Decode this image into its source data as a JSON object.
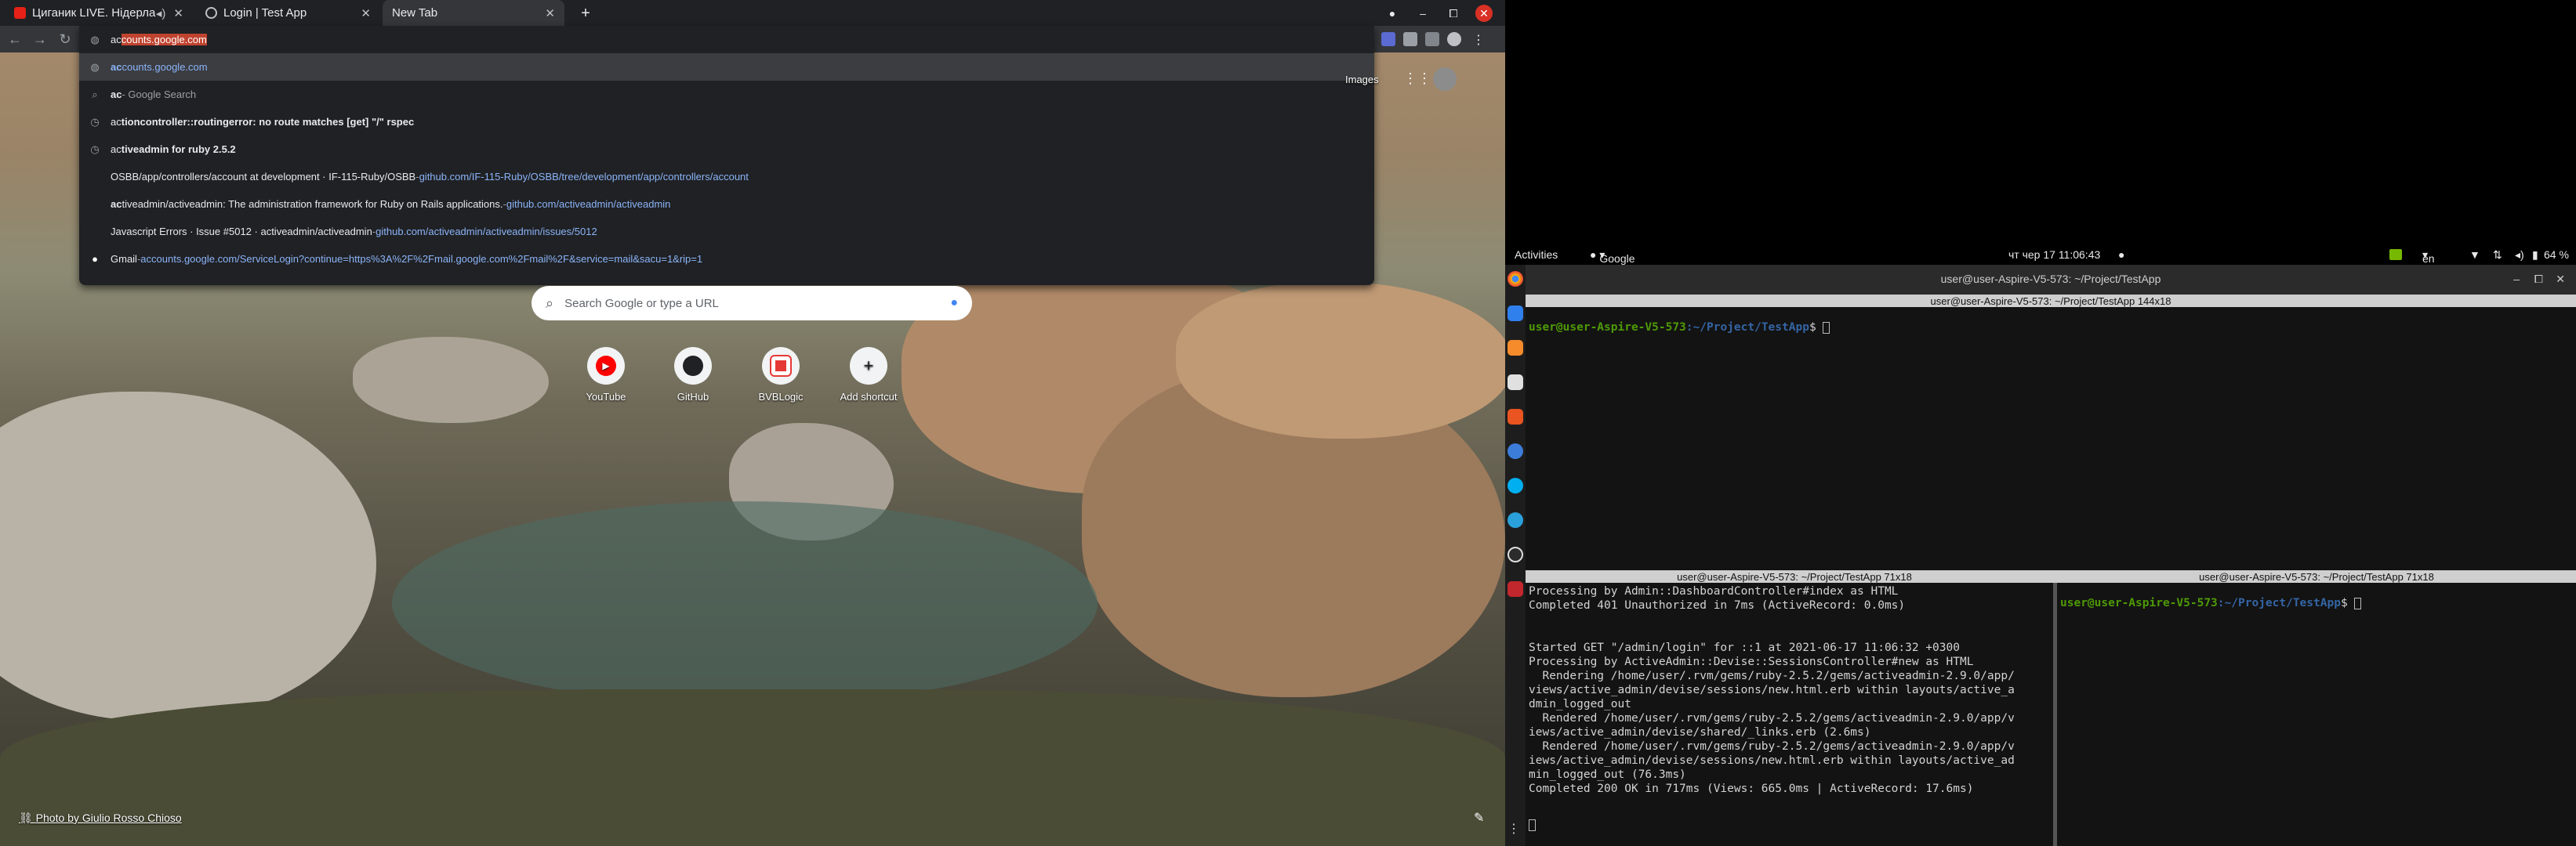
{
  "chrome": {
    "tabs": [
      {
        "label": "Циганик LIVE. Нідерла",
        "active": false,
        "favicon": "youtube-icon"
      },
      {
        "label": "Login | Test App",
        "active": false,
        "favicon": "globe-icon"
      },
      {
        "label": "New Tab",
        "active": true
      }
    ],
    "omnibox": {
      "typed": "ac",
      "autocomplete": "counts.google.com",
      "suggestions": [
        {
          "icon": "globe-icon",
          "bold": "ac",
          "rest": "counts.google.com",
          "suffix": "",
          "url": "",
          "style": "url"
        },
        {
          "icon": "search-icon",
          "bold": "ac",
          "rest": "",
          "suffix": " - Google Search",
          "url": ""
        },
        {
          "icon": "history-icon",
          "bold": "ac",
          "rest": "tioncontroller::routingerror: no route matches [get] \"/\" rspec",
          "suffix": "",
          "url": ""
        },
        {
          "icon": "history-icon",
          "bold": "ac",
          "rest": "tiveadmin for ruby 2.5.2",
          "suffix": "",
          "url": ""
        },
        {
          "icon": "",
          "bold": "",
          "rest": "OSBB/app/controllers/account at development · IF-115-Ruby/OSBB",
          "suffix": " - ",
          "url": "github.com/IF-115-Ruby/OSBB/tree/development/app/controllers/account"
        },
        {
          "icon": "",
          "bold": "ac",
          "rest": "tiveadmin/activeadmin: The administration framework for Ruby on Rails applications.",
          "suffix": " - ",
          "url": "github.com/activeadmin/activeadmin"
        },
        {
          "icon": "",
          "bold": "",
          "rest": "Javascript Errors · Issue #5012 · activeadmin/activeadmin",
          "suffix": " - ",
          "url": "github.com/activeadmin/activeadmin/issues/5012"
        },
        {
          "icon": "google-icon",
          "bold": "",
          "rest": "Gmail",
          "suffix": " - ",
          "url": "accounts.google.com/ServiceLogin?continue=https%3A%2F%2Fmail.google.com%2Fmail%2F&service=mail&sacu=1&rip=1"
        }
      ]
    },
    "images_link": "Images",
    "search_placeholder": "Search Google or type a URL",
    "shortcuts": [
      {
        "label": "YouTube",
        "icon": "youtube-icon"
      },
      {
        "label": "GitHub",
        "icon": "github-icon"
      },
      {
        "label": "BVBLogic",
        "icon": "bvblogic-icon"
      },
      {
        "label": "Add shortcut",
        "icon": "plus-icon"
      }
    ],
    "photo_credit": "Photo by Giulio Rosso Chioso"
  },
  "ubuntu": {
    "activities": "Activities",
    "app_menu": "Google Chrome",
    "clock": "чт чер 17  11:06:43",
    "lang": "en",
    "battery": "64 %",
    "terminal_title": "user@user-Aspire-V5-573: ~/Project/TestApp",
    "pane_top_title": "user@user-Aspire-V5-573: ~/Project/TestApp 144x18",
    "pane_bl_title": "user@user-Aspire-V5-573: ~/Project/TestApp 71x18",
    "pane_br_title": "user@user-Aspire-V5-573: ~/Project/TestApp 71x18",
    "prompt_user": "user@user-Aspire-V5-573",
    "prompt_path": ":~/Project/TestApp",
    "log_lines": [
      "Processing by Admin::DashboardController#index as HTML",
      "Completed 401 Unauthorized in 7ms (ActiveRecord: 0.0ms)",
      "",
      "",
      "Started GET \"/admin/login\" for ::1 at 2021-06-17 11:06:32 +0300",
      "Processing by ActiveAdmin::Devise::SessionsController#new as HTML",
      "  Rendering /home/user/.rvm/gems/ruby-2.5.2/gems/activeadmin-2.9.0/app/",
      "views/active_admin/devise/sessions/new.html.erb within layouts/active_a",
      "dmin_logged_out",
      "  Rendered /home/user/.rvm/gems/ruby-2.5.2/gems/activeadmin-2.9.0/app/v",
      "iews/active_admin/devise/shared/_links.erb (2.6ms)",
      "  Rendered /home/user/.rvm/gems/ruby-2.5.2/gems/activeadmin-2.9.0/app/v",
      "iews/active_admin/devise/sessions/new.html.erb within layouts/active_ad",
      "min_logged_out (76.3ms)",
      "Completed 200 OK in 717ms (Views: 665.0ms | ActiveRecord: 17.6ms)"
    ]
  }
}
